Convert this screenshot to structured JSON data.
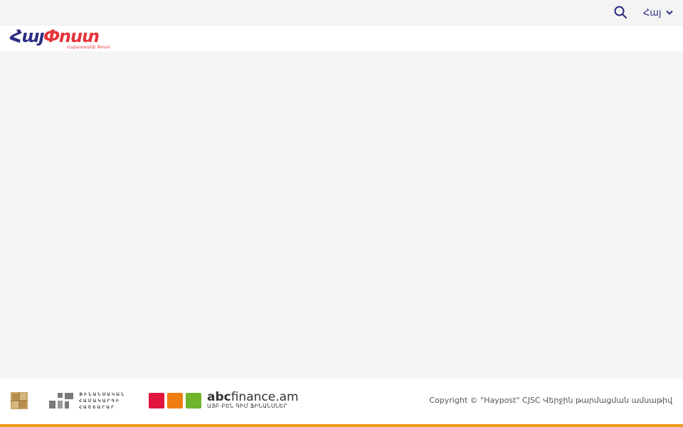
{
  "topbar": {
    "search_icon": "search-icon",
    "language": "Հայ",
    "language_icon": "chevron-down-icon"
  },
  "header": {
    "logo_text_part1": "Հայ",
    "logo_text_part2": "Փոստ",
    "logo_subtitle": "Հայաստանի Փոստ"
  },
  "colors": {
    "brand_blue": "#2d2e83",
    "brand_red": "#e6343a",
    "footer_accent": "#ef9a1b"
  },
  "footer": {
    "partner_2_text_line1": "ՖԻՆԱՆՍԱԿԱՆ",
    "partner_2_text_line2": "ՀԱՄԱԿԱՐԳԻ",
    "partner_2_text_line3": "ՀԱՇՏԱՐԱՐ",
    "partner_3_name_bold": "abc",
    "partner_3_name_rest": "finance.am",
    "partner_3_tagline": "ԱՅԲ ԲԵՆ ԳԻՄ ՖԻՆԱՆՍՆԵՐ",
    "copyright": "Copyright © \"Haypost\" CJSC  Վերջին թարմացման ամսաթիվ"
  }
}
